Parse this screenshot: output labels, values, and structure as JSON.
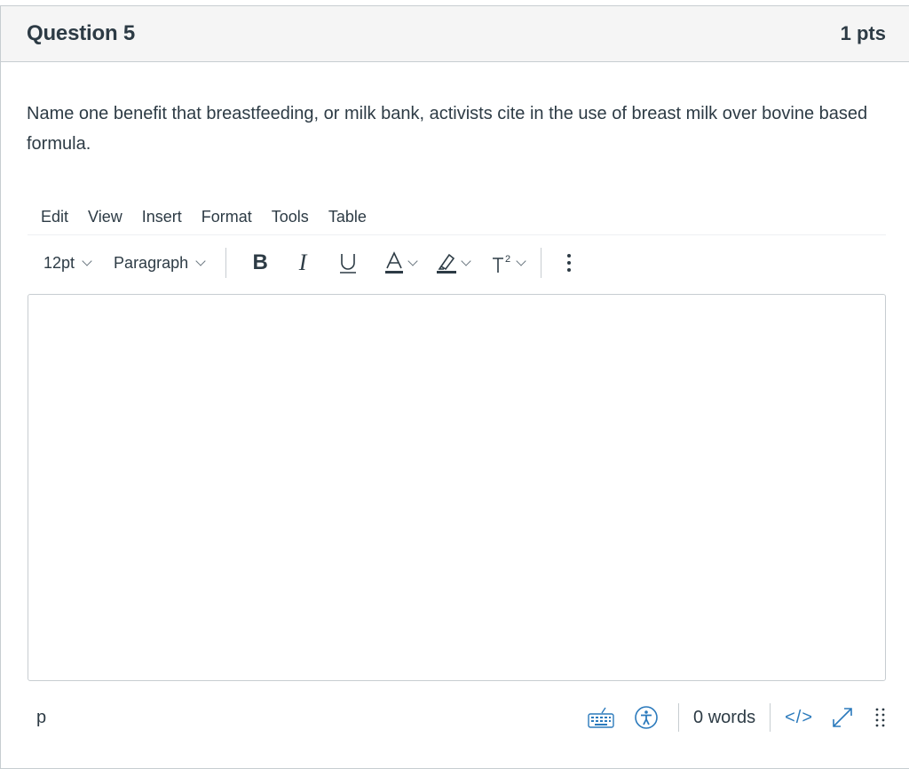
{
  "question": {
    "title": "Question 5",
    "points": "1 pts",
    "text": "Name one benefit that breastfeeding, or milk bank, activists cite in the use of breast milk over bovine based formula."
  },
  "menubar": {
    "items": [
      "Edit",
      "View",
      "Insert",
      "Format",
      "Tools",
      "Table"
    ]
  },
  "toolbar": {
    "font_size": "12pt",
    "block_format": "Paragraph",
    "bold_label": "B",
    "italic_label": "I",
    "underline_label": "U",
    "more_icon": "more-vertical-icon"
  },
  "editor": {
    "content": ""
  },
  "statusbar": {
    "path": "p",
    "word_count": "0 words",
    "html_toggle": "</>"
  },
  "colors": {
    "text": "#2d3b45",
    "link": "#2b7abc",
    "header_bg": "#f5f5f5",
    "border": "#c7cdd1"
  }
}
